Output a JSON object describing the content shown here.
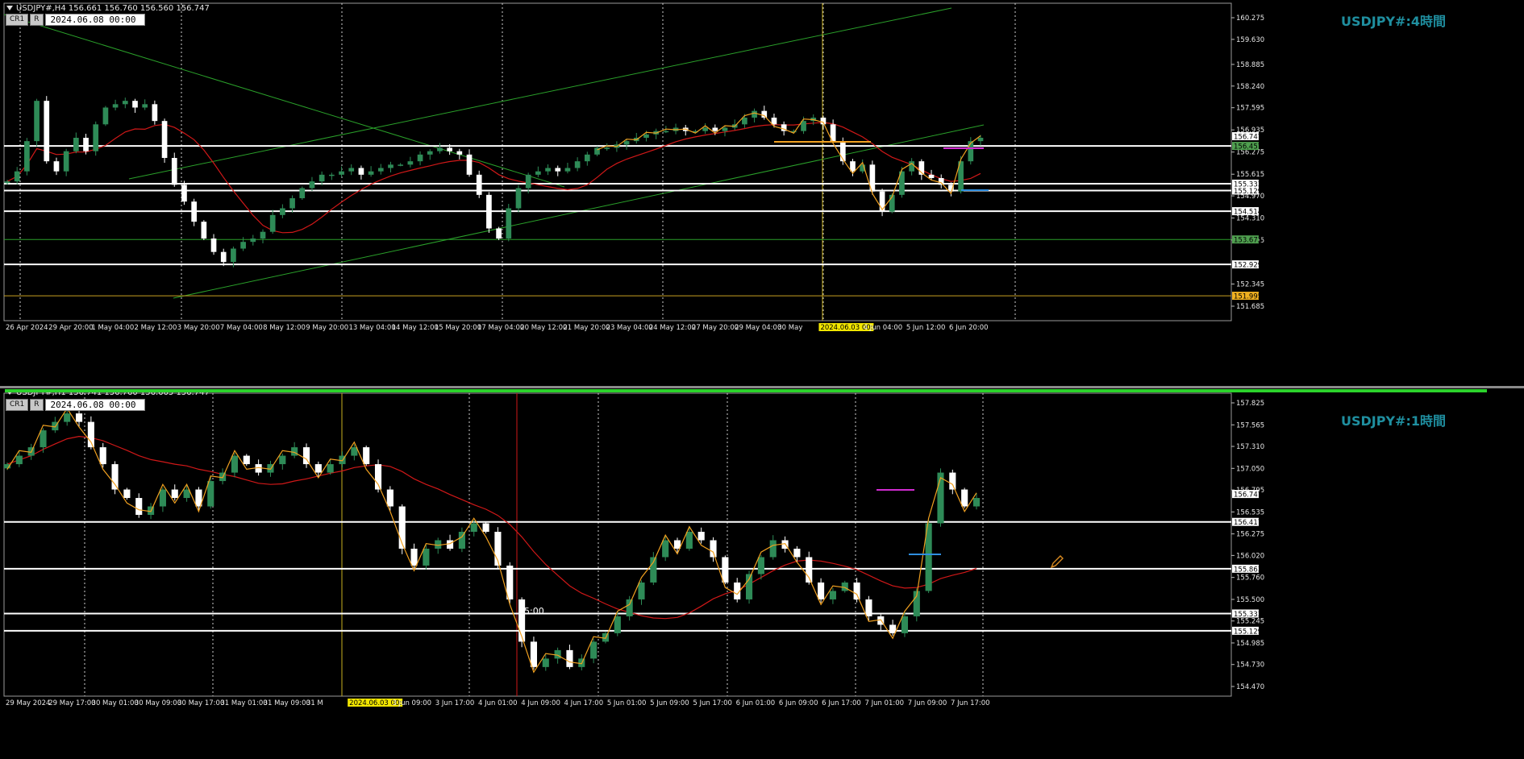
{
  "window": {
    "top_header": "USDJPY#,H4  156.661 156.760 156.560 156.747",
    "bottom_header": "USDJPY#,H1  156.741 156.760 156.665 156.747",
    "btn_cr1": "CR1",
    "btn_r": "R",
    "date_input": "2024.06.08  00:00",
    "top_watermark": "USDJPY#:4時間",
    "bottom_watermark": "USDJPY#:1時間",
    "h1_time_label": "15:00"
  },
  "colors": {
    "background": "#000000",
    "bull": "#2e8b57",
    "bear": "#ffffff",
    "ma_red": "#d01818",
    "zigzag_orange": "#f0a020",
    "trend_green": "#2aa02a",
    "level_white": "#ffffff",
    "watermark": "#1f8fa0"
  },
  "chart_data": [
    {
      "type": "candlestick",
      "title": "USDJPY#:4時間",
      "symbol": "USDJPY#",
      "timeframe": "H4",
      "ohlc": {
        "open": 156.661,
        "high": 156.76,
        "low": 156.56,
        "close": 156.747
      },
      "ylim": [
        151.685,
        160.275
      ],
      "y_ticks": [
        "160.275",
        "159.630",
        "158.885",
        "158.240",
        "157.595",
        "156.935",
        "156.275",
        "155.615",
        "154.970",
        "154.310",
        "153.655",
        "152.345",
        "151.685"
      ],
      "price_labels": [
        {
          "text": "156.747",
          "value": 156.747,
          "color": "#ffffff"
        },
        {
          "text": "156.457",
          "value": 156.457,
          "color": "#4f9f4f"
        },
        {
          "text": "155.333",
          "value": 155.333,
          "color": "#ffffff"
        },
        {
          "text": "155.129",
          "value": 155.129,
          "color": "#ffffff"
        },
        {
          "text": "154.514",
          "value": 154.514,
          "color": "#ffffff"
        },
        {
          "text": "153.672",
          "value": 153.672,
          "color": "#4f9f4f"
        },
        {
          "text": "152.929",
          "value": 152.929,
          "color": "#ffffff"
        },
        {
          "text": "151.995",
          "value": 151.995,
          "color": "#f0b020"
        }
      ],
      "x_ticks": [
        "26 Apr 2024",
        "29 Apr 20:00",
        "1 May 04:00",
        "2 May 12:00",
        "3 May 20:00",
        "7 May 04:00",
        "8 May 12:00",
        "9 May 20:00",
        "13 May 04:00",
        "14 May 12:00",
        "15 May 20:00",
        "17 May 04:00",
        "20 May 12:00",
        "21 May 20:00",
        "23 May 04:00",
        "24 May 12:00",
        "27 May 20:00",
        "29 May 04:00",
        "30 May",
        "2024.06.03 00:00",
        "4 Jun 04:00",
        "5 Jun 12:00",
        "6 Jun 20:00"
      ],
      "highlighted_x_label": "2024.06.03 00:00",
      "horizontal_levels": [
        156.457,
        155.333,
        155.129,
        154.514,
        152.929
      ],
      "green_levels": [
        153.672
      ],
      "orange_levels": [
        151.995
      ],
      "close_path": [
        155.4,
        155.7,
        156.6,
        157.8,
        156.0,
        155.7,
        156.3,
        156.7,
        156.3,
        157.1,
        157.6,
        157.7,
        157.8,
        157.6,
        157.7,
        157.2,
        156.1,
        155.3,
        154.8,
        154.2,
        153.7,
        153.3,
        153.0,
        153.4,
        153.6,
        153.7,
        153.9,
        154.4,
        154.6,
        154.9,
        155.2,
        155.4,
        155.6,
        155.6,
        155.7,
        155.8,
        155.6,
        155.7,
        155.8,
        155.9,
        155.9,
        156.0,
        156.2,
        156.3,
        156.4,
        156.3,
        156.2,
        155.6,
        155.0,
        154.0,
        153.7,
        154.6,
        155.2,
        155.6,
        155.7,
        155.8,
        155.7,
        155.8,
        156.0,
        156.2,
        156.4,
        156.4,
        156.5,
        156.6,
        156.7,
        156.8,
        156.9,
        156.9,
        157.0,
        156.9,
        156.9,
        157.0,
        156.9,
        157.0,
        157.1,
        157.3,
        157.5,
        157.3,
        157.1,
        156.9,
        156.9,
        157.2,
        157.3,
        157.1,
        156.6,
        156.0,
        155.7,
        155.9,
        155.1,
        154.5,
        155.0,
        155.7,
        156.0,
        155.6,
        155.5,
        155.3,
        155.1,
        156.0,
        156.6,
        156.7
      ]
    },
    {
      "type": "candlestick",
      "title": "USDJPY#:1時間",
      "symbol": "USDJPY#",
      "timeframe": "H1",
      "ohlc": {
        "open": 156.741,
        "high": 156.76,
        "low": 156.665,
        "close": 156.747
      },
      "ylim": [
        154.47,
        157.825
      ],
      "y_ticks": [
        "157.825",
        "157.565",
        "157.310",
        "157.050",
        "156.795",
        "156.535",
        "156.275",
        "156.020",
        "155.760",
        "155.500",
        "155.245",
        "154.985",
        "154.730",
        "154.470"
      ],
      "price_labels": [
        {
          "text": "156.747",
          "value": 156.747,
          "color": "#ffffff"
        },
        {
          "text": "156.417",
          "value": 156.417,
          "color": "#ffffff"
        },
        {
          "text": "155.863",
          "value": 155.863,
          "color": "#ffffff"
        },
        {
          "text": "155.333",
          "value": 155.333,
          "color": "#ffffff"
        },
        {
          "text": "155.129",
          "value": 155.129,
          "color": "#ffffff"
        }
      ],
      "x_ticks": [
        "29 May 2024",
        "29 May 17:00",
        "30 May 01:00",
        "30 May 09:00",
        "30 May 17:00",
        "31 May 01:00",
        "31 May 09:00",
        "31 M",
        "2024.06.03 00:00",
        "3 Jun 09:00",
        "3 Jun 17:00",
        "4 Jun 01:00",
        "4 Jun 09:00",
        "4 Jun 17:00",
        "5 Jun 01:00",
        "5 Jun 09:00",
        "5 Jun 17:00",
        "6 Jun 01:00",
        "6 Jun 09:00",
        "6 Jun 17:00",
        "7 Jun 01:00",
        "7 Jun 09:00",
        "7 Jun 17:00"
      ],
      "highlighted_x_label": "2024.06.03 00:00",
      "horizontal_levels": [
        156.417,
        155.863,
        155.333,
        155.129
      ],
      "close_path": [
        157.1,
        157.2,
        157.3,
        157.5,
        157.6,
        157.7,
        157.6,
        157.3,
        157.1,
        156.8,
        156.7,
        156.5,
        156.6,
        156.8,
        156.7,
        156.8,
        156.6,
        156.9,
        157.0,
        157.2,
        157.1,
        157.0,
        157.1,
        157.2,
        157.3,
        157.1,
        157.0,
        157.1,
        157.2,
        157.3,
        157.1,
        156.8,
        156.6,
        156.1,
        155.9,
        156.1,
        156.2,
        156.1,
        156.3,
        156.4,
        156.3,
        155.9,
        155.5,
        155.0,
        154.7,
        154.8,
        154.9,
        154.7,
        154.8,
        155.0,
        155.1,
        155.3,
        155.5,
        155.7,
        156.0,
        156.2,
        156.1,
        156.3,
        156.2,
        156.0,
        155.7,
        155.5,
        155.8,
        156.0,
        156.2,
        156.1,
        156.0,
        155.7,
        155.5,
        155.6,
        155.7,
        155.5,
        155.3,
        155.2,
        155.1,
        155.3,
        155.6,
        156.4,
        157.0,
        156.8,
        156.6,
        156.7
      ]
    }
  ]
}
